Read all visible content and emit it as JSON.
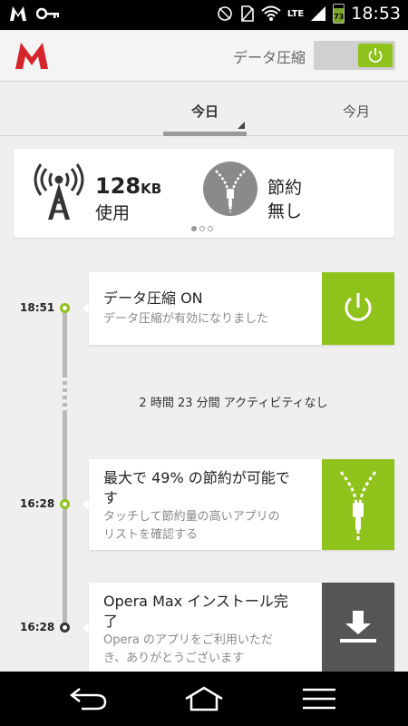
{
  "status_bar": {
    "time": "18:53",
    "network": "LTE",
    "battery": "73",
    "icons": [
      "opera-m-icon",
      "key-icon",
      "notification-icon",
      "no-sim-icon",
      "wifi-icon",
      "signal-icon",
      "battery-icon"
    ]
  },
  "header": {
    "compression_label": "データ圧縮",
    "toggle_state": "on",
    "accent": "#8fc21a",
    "brand": "#d6242b"
  },
  "tabs": {
    "today": "今日",
    "month": "今月"
  },
  "summary": {
    "usage_value": "128",
    "usage_unit": "KB",
    "usage_label": "使用",
    "saving_label_1": "節約",
    "saving_label_2": "無し",
    "page_index": 0,
    "page_count": 3
  },
  "timeline": {
    "no_activity": "2 時間 23 分間 アクティビティなし",
    "events": [
      {
        "time": "18:51",
        "title": "データ圧縮 ON",
        "desc": "データ圧縮が有効になりました",
        "icon": "power-icon",
        "color": "#8fc21a"
      },
      {
        "time": "16:28",
        "title_1": "最大で 49% の節約が可能で",
        "title_2": "す",
        "desc_1": "タッチして節約量の高いアプリの",
        "desc_2": "リストを確認する",
        "icon": "zipper-icon",
        "color": "#8fc21a"
      },
      {
        "time": "16:28",
        "title_1": "Opera Max インストール完",
        "title_2": "了",
        "desc_1": "Opera のアプリをご利用いただ",
        "desc_2": "き、ありがとうございます",
        "icon": "download-icon",
        "color": "#555555"
      }
    ]
  },
  "nav": {
    "icons": [
      "back-icon",
      "home-icon",
      "menu-icon"
    ]
  }
}
